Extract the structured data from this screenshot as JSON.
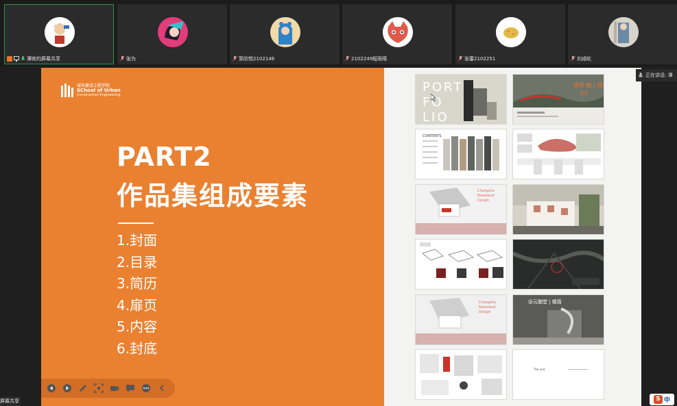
{
  "participants": [
    {
      "name": "谭奕的屏幕共享",
      "sharing": true,
      "active": true,
      "avatar_bg": "#ffffff"
    },
    {
      "name": "张为",
      "sharing": false,
      "active": false,
      "avatar_bg": "#e23c7b"
    },
    {
      "name": "郭欣悦2102146",
      "sharing": false,
      "active": false,
      "avatar_bg": "#8fc7e8"
    },
    {
      "name": "2102249程雨晴",
      "sharing": false,
      "active": false,
      "avatar_bg": "#ffffff"
    },
    {
      "name": "张蕾2102251",
      "sharing": false,
      "active": false,
      "avatar_bg": "#ffffff"
    },
    {
      "name": "刘成屹",
      "sharing": false,
      "active": false,
      "avatar_bg": "#cfcfcf"
    }
  ],
  "slide": {
    "logo_line1": "城市建设工程学院",
    "logo_line2": "SChool of Urban",
    "logo_line3": "Construction Engineering",
    "title": "PART2",
    "subtitle": "作品集组成要素",
    "items": [
      "1.封面",
      "2.目录",
      "3.简历",
      "4.扉页",
      "5.内容",
      "6.封底"
    ],
    "thumb_text": {
      "portfolio": "PORT FO LIO",
      "contents": "CONTENTS",
      "changsha": "Changsha Newsland Design",
      "changsha2": "Changsha Newsland Design",
      "wuhan": "@元御堂 | 楼面",
      "last": "The end",
      "chinese_title": "城市·曲 | 成城",
      "number": "03"
    },
    "colors": {
      "accent": "#ea8131"
    }
  },
  "toolbar": {
    "icons": [
      "prev-icon",
      "next-icon",
      "pen-icon",
      "screenshot-icon",
      "camera-icon",
      "comment-icon",
      "more-icon",
      "collapse-icon"
    ]
  },
  "speaking_label": "正在讲话: 谭",
  "bottom_left_label": "屏幕共享",
  "ime_label": "中",
  "ime_logo": "S"
}
